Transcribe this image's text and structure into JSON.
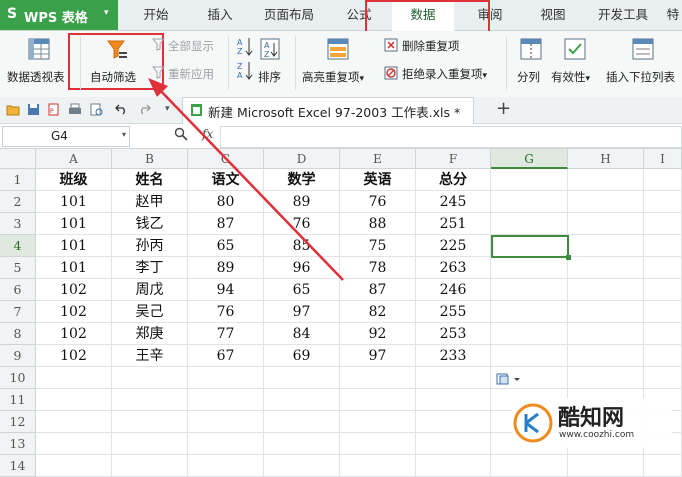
{
  "app": {
    "logo_s": "S",
    "logo_title": "WPS 表格",
    "logo_caret": "▾"
  },
  "tabs": [
    "开始",
    "插入",
    "页面布局",
    "公式",
    "数据",
    "审阅",
    "视图",
    "开发工具",
    "特"
  ],
  "active_tab": "数据",
  "ribbon": {
    "pivot": "数据透视表",
    "autofilter": "自动筛选",
    "show_all": "全部显示",
    "reapply": "重新应用",
    "sort": "排序",
    "highlight_dup": "高亮重复项",
    "remove_dup": "删除重复项",
    "reject_dup": "拒绝录入重复项",
    "split_col": "分列",
    "validity": "有效性",
    "insert_dropdown": "插入下拉列表",
    "caret": "▾"
  },
  "file_tab": {
    "title": "新建 Microsoft Excel 97-2003 工作表.xls *",
    "add": "+"
  },
  "formula_bar": {
    "name_box": "G4",
    "fx": "fx"
  },
  "sheet": {
    "columns": [
      "A",
      "B",
      "C",
      "D",
      "E",
      "F",
      "G",
      "H",
      "I"
    ],
    "rows": [
      "1",
      "2",
      "3",
      "4",
      "5",
      "6",
      "7",
      "8",
      "9",
      "10",
      "11",
      "12",
      "13",
      "14"
    ],
    "selected_cell": "G4",
    "data": [
      [
        "班级",
        "姓名",
        "语文",
        "数学",
        "英语",
        "总分"
      ],
      [
        "101",
        "赵甲",
        "80",
        "89",
        "76",
        "245"
      ],
      [
        "101",
        "钱乙",
        "87",
        "76",
        "88",
        "251"
      ],
      [
        "101",
        "孙丙",
        "65",
        "85",
        "75",
        "225"
      ],
      [
        "101",
        "李丁",
        "89",
        "96",
        "78",
        "263"
      ],
      [
        "102",
        "周戊",
        "94",
        "65",
        "87",
        "246"
      ],
      [
        "102",
        "吴己",
        "76",
        "97",
        "82",
        "255"
      ],
      [
        "102",
        "郑庚",
        "77",
        "84",
        "92",
        "253"
      ],
      [
        "102",
        "王辛",
        "67",
        "69",
        "97",
        "233"
      ]
    ]
  },
  "watermark": {
    "brand": "酷知网",
    "url": "www.coozhi.com"
  },
  "colors": {
    "accent_green": "#3aa14a",
    "annotation_red": "#e0303a"
  }
}
